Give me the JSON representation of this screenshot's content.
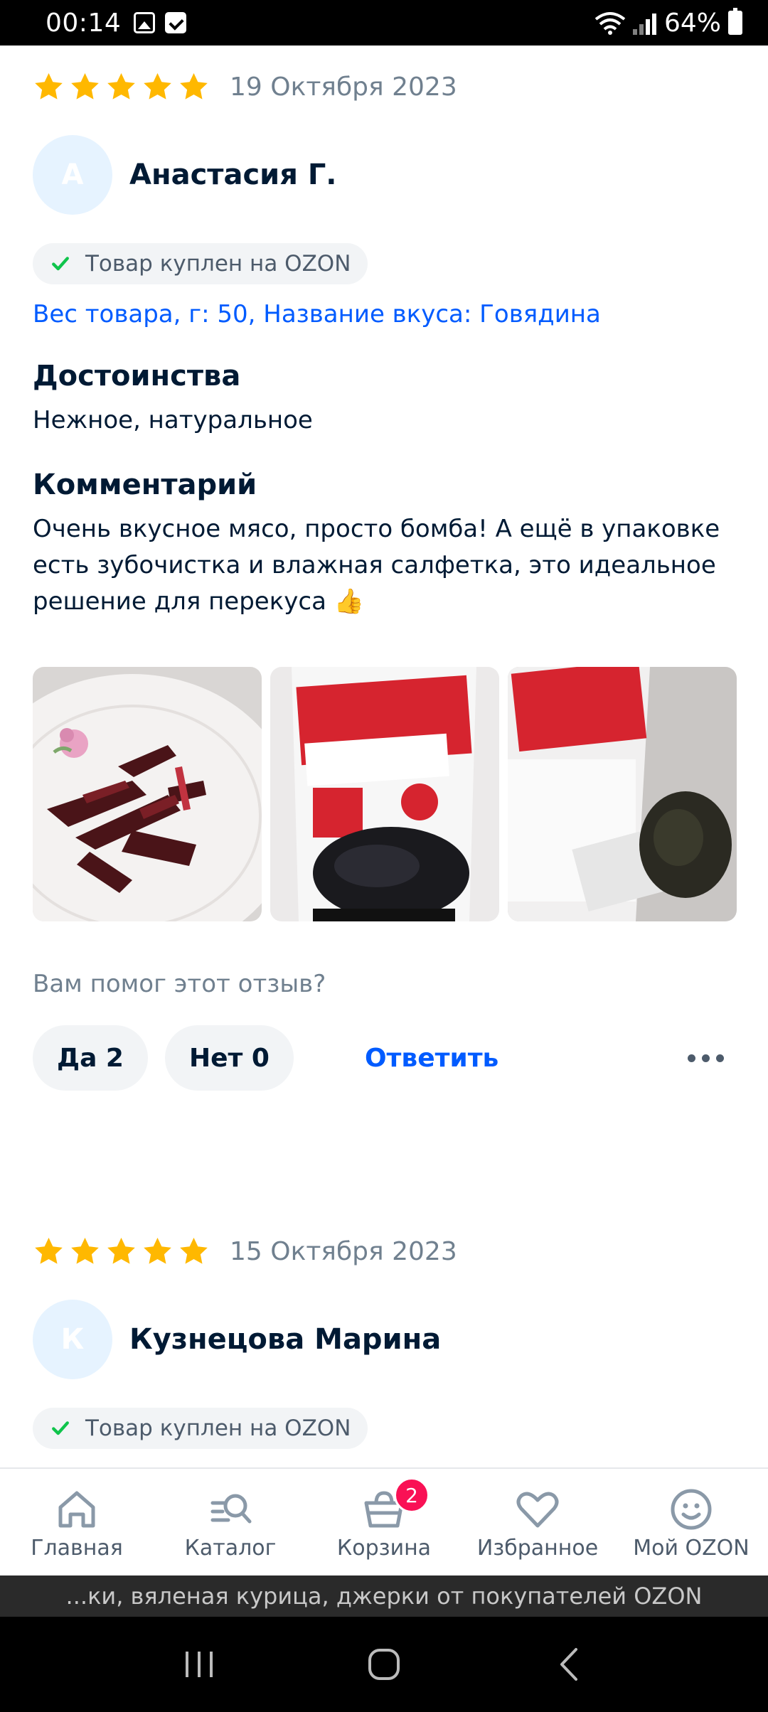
{
  "status_bar": {
    "time": "00:14",
    "battery": "64%"
  },
  "colors": {
    "star": "#ffb800",
    "link": "#005bff",
    "badge_red": "#f91155",
    "check_green": "#10c44c"
  },
  "reviews": [
    {
      "rating": 5,
      "date": "19 Октября 2023",
      "avatar_letter": "А",
      "author": "Анастасия Г.",
      "badge": "Товар куплен на OZON",
      "variant": "Вес товара, г: 50, Название вкуса: Говядина",
      "pros_title": "Достоинства",
      "pros": "Нежное, натуральное",
      "comment_title": "Комментарий",
      "comment": "Очень вкусное мясо, просто бомба! А ещё в упаковке есть зубочистка и влажная салфетка, это идеальное решение для перекуса 👍",
      "photos": [
        "photo-jerky-on-plate",
        "photo-package-front",
        "photo-package-open"
      ],
      "helpful_question": "Вам помог этот отзыв?",
      "yes_label": "Да 2",
      "no_label": "Нет 0",
      "reply_label": "Ответить"
    },
    {
      "rating": 5,
      "date": "15 Октября 2023",
      "avatar_letter": "К",
      "author": "Кузнецова Марина",
      "badge": "Товар куплен на OZON"
    }
  ],
  "bottom_nav": [
    {
      "label": "Главная",
      "icon": "home-icon"
    },
    {
      "label": "Каталог",
      "icon": "catalog-search-icon"
    },
    {
      "label": "Корзина",
      "icon": "cart-icon",
      "badge": "2"
    },
    {
      "label": "Избранное",
      "icon": "heart-icon"
    },
    {
      "label": "Мой OZON",
      "icon": "profile-smile-icon"
    }
  ],
  "page_title_bar": "...ки, вяленая курица, джерки от покупателей OZON"
}
